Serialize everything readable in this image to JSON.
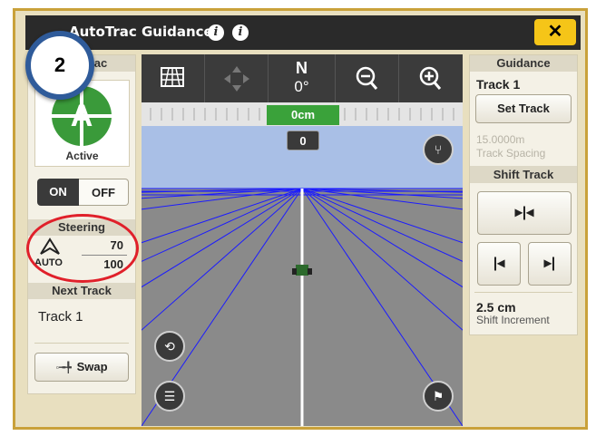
{
  "window": {
    "title": "AutoTrac Guidance",
    "close_label": "✕"
  },
  "badge": {
    "number": "2"
  },
  "left_panel": {
    "header": "AutoTrac",
    "status_letter": "A",
    "status_label": "Active",
    "toggle": {
      "on_label": "ON",
      "off_label": "OFF",
      "selected": "ON"
    },
    "steering": {
      "header": "Steering",
      "mode_label": "AUTO",
      "value_top": "70",
      "value_bottom": "100"
    },
    "next_track": {
      "header": "Next Track",
      "value": "Track 1"
    },
    "swap_label": "Swap"
  },
  "toolbar": {
    "heading_letter": "N",
    "heading_value": "0°",
    "offset_value": "0cm",
    "track_number": "0"
  },
  "right_panel": {
    "header": "Guidance",
    "track_name": "Track 1",
    "set_track_label": "Set Track",
    "track_spacing_value": "15.0000m",
    "track_spacing_label": "Track Spacing",
    "shift_track_header": "Shift Track",
    "shift_increment_value": "2.5 cm",
    "shift_increment_label": "Shift Increment"
  },
  "colors": {
    "accent_yellow": "#f5c518",
    "active_green": "#3a9a3a",
    "offset_green": "#3aa23a",
    "annotation_red": "#e0202a",
    "badge_blue": "#2f5b9a"
  }
}
